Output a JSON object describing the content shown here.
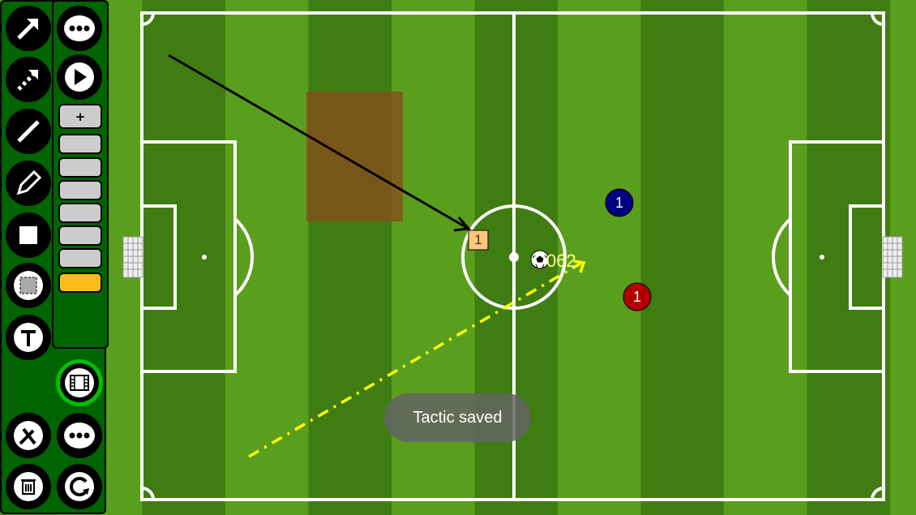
{
  "toolbar": {
    "left_tools": [
      {
        "icon": "arrow-icon"
      },
      {
        "icon": "dashed-arrow-icon"
      },
      {
        "icon": "line-icon"
      },
      {
        "icon": "pencil-icon"
      },
      {
        "icon": "square-icon"
      },
      {
        "icon": "area-select-icon"
      },
      {
        "icon": "text-icon"
      },
      {
        "icon": "tools-icon"
      },
      {
        "icon": "trash-icon"
      }
    ],
    "right_tools": [
      {
        "icon": "more-icon"
      },
      {
        "icon": "play-icon"
      },
      {
        "icon": "film-icon"
      },
      {
        "icon": "more-icon"
      },
      {
        "icon": "refresh-icon"
      }
    ],
    "frames": {
      "add_label": "+",
      "count": 7,
      "selected_index": 6
    },
    "colors": {
      "panel": "#006400",
      "selected_frame": "#fbbd1c",
      "film_ring": "#00c000"
    }
  },
  "pitch": {
    "markers": [
      {
        "type": "square",
        "label": "1",
        "color": "#ffc77a"
      },
      {
        "type": "player",
        "label": "1",
        "color": "#000080"
      },
      {
        "type": "player",
        "label": "1",
        "color": "#b00000"
      }
    ],
    "ball_label": "062",
    "zone_color": "#8b4a1c",
    "arrow_color": "#000000",
    "dash_arrow_color": "#ffff00"
  },
  "toast": {
    "text": "Tactic saved"
  }
}
